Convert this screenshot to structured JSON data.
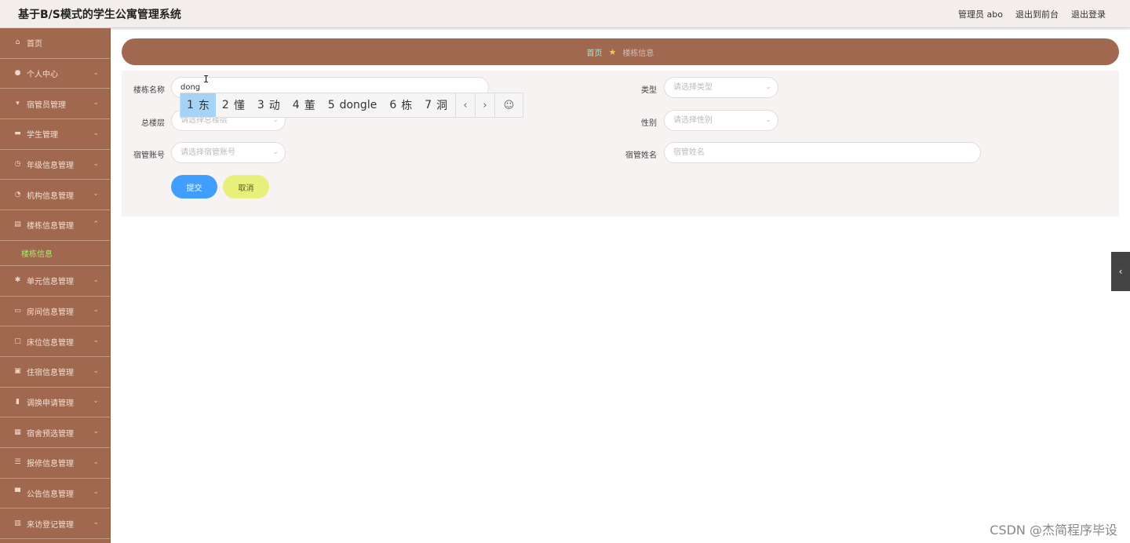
{
  "header": {
    "title": "基于B/S模式的学生公寓管理系统",
    "admin_label": "管理员 abo",
    "goto_front": "退出到前台",
    "logout": "退出登录"
  },
  "sidebar": {
    "items": [
      {
        "label": "首页",
        "icon": "home-icon",
        "glyph": "⌂",
        "has_chevron": false
      },
      {
        "label": "个人中心",
        "icon": "user-icon",
        "glyph": "●",
        "has_chevron": true
      },
      {
        "label": "宿管员管理",
        "icon": "person-icon",
        "glyph": "▾",
        "has_chevron": true
      },
      {
        "label": "学生管理",
        "icon": "briefcase-icon",
        "glyph": "▬",
        "has_chevron": true
      },
      {
        "label": "年级信息管理",
        "icon": "clock-icon",
        "glyph": "◷",
        "has_chevron": true
      },
      {
        "label": "机构信息管理",
        "icon": "dashboard-icon",
        "glyph": "◔",
        "has_chevron": true
      },
      {
        "label": "楼栋信息管理",
        "icon": "clipboard-icon",
        "glyph": "▤",
        "has_chevron": true,
        "expanded": true
      }
    ],
    "active_sub": "楼栋信息",
    "items_after": [
      {
        "label": "单元信息管理",
        "icon": "settings-icon",
        "glyph": "✱"
      },
      {
        "label": "房间信息管理",
        "icon": "card-icon",
        "glyph": "▭"
      },
      {
        "label": "床位信息管理",
        "icon": "chat-icon",
        "glyph": "▢"
      },
      {
        "label": "住宿信息管理",
        "icon": "doc-icon",
        "glyph": "▣"
      },
      {
        "label": "调换申请管理",
        "icon": "mic-icon",
        "glyph": "▮"
      },
      {
        "label": "宿舍预选管理",
        "icon": "folder-icon",
        "glyph": "▦"
      },
      {
        "label": "报修信息管理",
        "icon": "list-icon",
        "glyph": "☰"
      },
      {
        "label": "公告信息管理",
        "icon": "monitor-icon",
        "glyph": "▀"
      },
      {
        "label": "来访登记管理",
        "icon": "lock-icon",
        "glyph": "▥"
      }
    ]
  },
  "breadcrumb": {
    "home": "首页",
    "current": "楼栋信息"
  },
  "form": {
    "building_name": {
      "label": "楼栋名称",
      "value": "dong"
    },
    "type": {
      "label": "类型",
      "placeholder": "请选择类型"
    },
    "total_floors": {
      "label": "总楼层",
      "placeholder": "请选择总楼层"
    },
    "gender": {
      "label": "性别",
      "placeholder": "请选择性别"
    },
    "manager_account": {
      "label": "宿管账号",
      "placeholder": "请选择宿管账号"
    },
    "manager_name": {
      "label": "宿管姓名",
      "placeholder": "宿管姓名"
    },
    "submit": "提交",
    "cancel": "取消"
  },
  "ime": {
    "candidates": [
      {
        "n": "1",
        "text": "东"
      },
      {
        "n": "2",
        "text": "懂"
      },
      {
        "n": "3",
        "text": "动"
      },
      {
        "n": "4",
        "text": "董"
      },
      {
        "n": "5",
        "text": "dongle"
      },
      {
        "n": "6",
        "text": "栋"
      },
      {
        "n": "7",
        "text": "洞"
      }
    ],
    "prev": "‹",
    "next": "›",
    "emoji": "☺"
  },
  "watermark": "CSDN @杰简程序毕设",
  "colors": {
    "sidebar": "#a0694f",
    "breadcrumb_home": "#7ef4e2",
    "active_sub": "#9cf06a",
    "submit": "#409eff",
    "cancel": "#e8ef7a"
  }
}
